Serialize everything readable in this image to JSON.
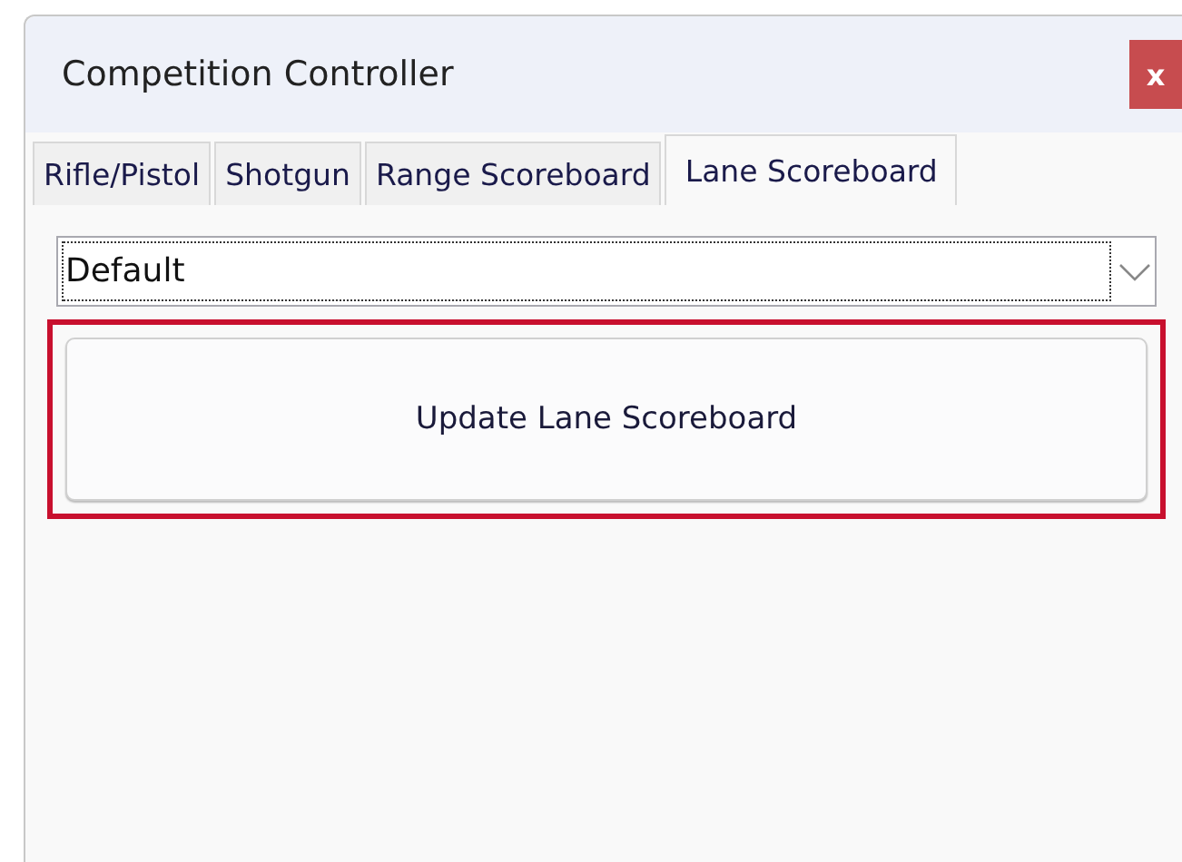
{
  "window": {
    "title": "Competition Controller",
    "close": "x"
  },
  "tabs": [
    {
      "label": "Rifle/Pistol",
      "selected": false
    },
    {
      "label": "Shotgun",
      "selected": false
    },
    {
      "label": "Range Scoreboard",
      "selected": false
    },
    {
      "label": "Lane Scoreboard",
      "selected": true
    }
  ],
  "dropdown": {
    "value": "Default"
  },
  "button": {
    "label": "Update Lane Scoreboard",
    "highlighted": true
  }
}
